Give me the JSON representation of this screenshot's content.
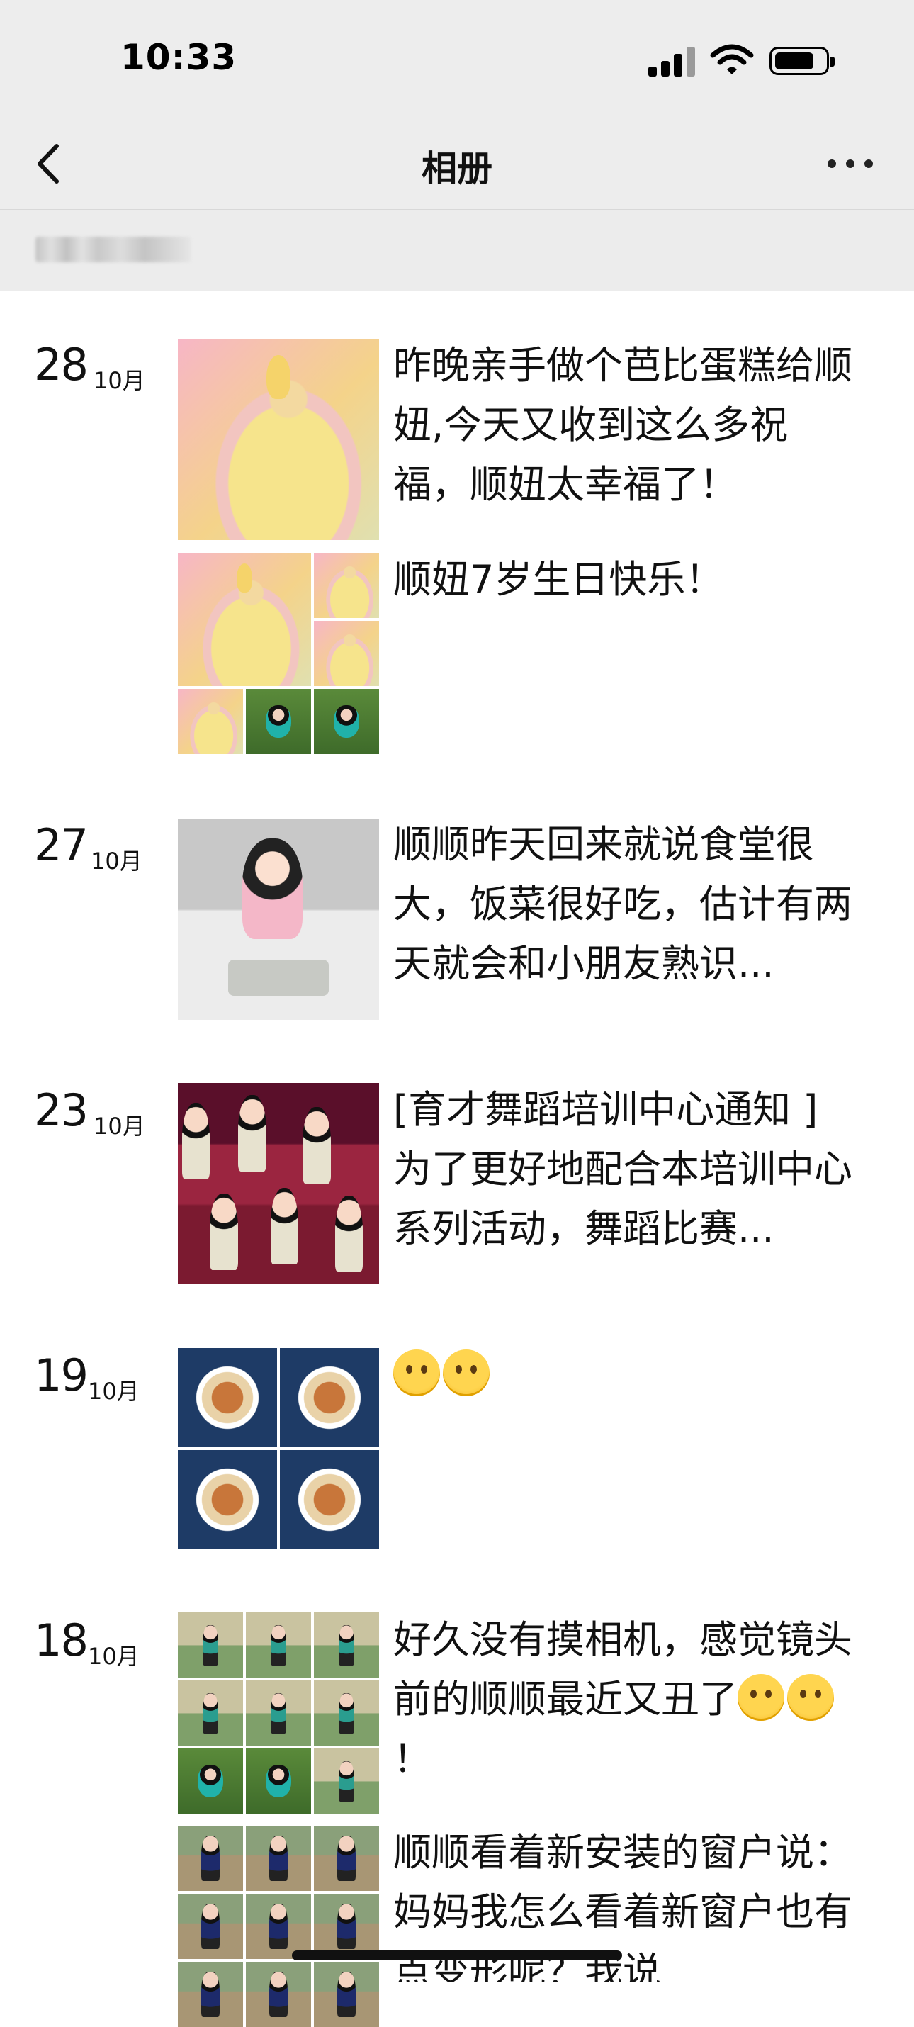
{
  "status_bar": {
    "time": "10:33"
  },
  "nav": {
    "title": "相册"
  },
  "entries": [
    {
      "day": "28",
      "month": "10月",
      "posts": [
        {
          "caption": "昨晚亲手做个芭比蛋糕给顺妞,今天又收到这么多祝福，顺妞太幸福了！"
        },
        {
          "caption": "顺妞7岁生日快乐！"
        }
      ]
    },
    {
      "day": "27",
      "month": "10月",
      "posts": [
        {
          "caption": "顺顺昨天回来就说食堂很大，饭菜很好吃，估计有两天就会和小朋友熟识..."
        }
      ]
    },
    {
      "day": "23",
      "month": "10月",
      "posts": [
        {
          "caption": "[育才舞蹈培训中心通知 ]为了更好地配合本培训中心系列活动，舞蹈比赛..."
        }
      ]
    },
    {
      "day": "19",
      "month": "10月",
      "posts": [
        {
          "caption": "",
          "emojis": [
            "smile-emoji",
            "wink-emoji"
          ]
        }
      ]
    },
    {
      "day": "18",
      "month": "10月",
      "posts": [
        {
          "caption": "好久没有摸相机，感觉镜头前的顺顺最近又丑了",
          "caption_end": "！",
          "emojis": [
            "eye-roll-emoji",
            "eye-roll-emoji"
          ]
        },
        {
          "caption": "顺顺看着新安装的窗户说：妈妈我怎么看着新窗户也有点变形呢？我说"
        }
      ]
    }
  ],
  "icons": {
    "back": "chevron-left-icon",
    "more": "more-dots-icon",
    "signal": "signal-icon",
    "wifi": "wifi-icon",
    "battery": "battery-icon"
  }
}
